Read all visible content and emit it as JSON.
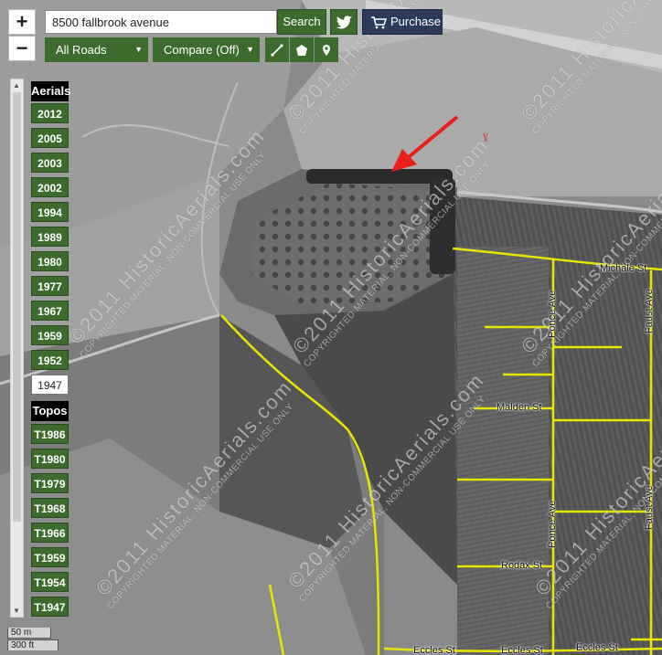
{
  "search": {
    "value": "8500 fallbrook avenue",
    "button_label": "Search"
  },
  "zoom": {
    "in_label": "+",
    "out_label": "−"
  },
  "social": {
    "icon": "twitter-icon"
  },
  "purchase": {
    "label": "Purchase",
    "icon": "cart-icon"
  },
  "overlay_select": {
    "value": "All Roads"
  },
  "compare_select": {
    "value": "Compare (Off)"
  },
  "tools": [
    {
      "name": "measure-line-icon"
    },
    {
      "name": "measure-area-icon"
    },
    {
      "name": "marker-icon"
    }
  ],
  "aerials": {
    "header": "Aerials",
    "years": [
      "2012",
      "2005",
      "2003",
      "2002",
      "1994",
      "1989",
      "1980",
      "1977",
      "1967",
      "1959",
      "1952",
      "1947"
    ],
    "selected": "1947"
  },
  "topos": {
    "header": "Topos",
    "years": [
      "T1986",
      "T1980",
      "T1979",
      "T1968",
      "T1966",
      "T1959",
      "T1954",
      "T1947"
    ]
  },
  "scale": {
    "metric": "50 m",
    "imperial": "300 ft"
  },
  "watermark": {
    "line1": "©2011 HistoricAerials.com",
    "line2": "COPYRIGHTED MATERIAL, NON-COMMERCIAL USE ONLY"
  },
  "streets": {
    "michale": "Michale St",
    "ponce": "Ponce Ave",
    "faust": "Faust Ave",
    "malden": "Malden St",
    "rodax": "Rodax St",
    "eccles": "Eccles St"
  },
  "colors": {
    "button_green": "#3d6b2e",
    "road_yellow": "#e8e600",
    "arrow_red": "#e8201a"
  }
}
